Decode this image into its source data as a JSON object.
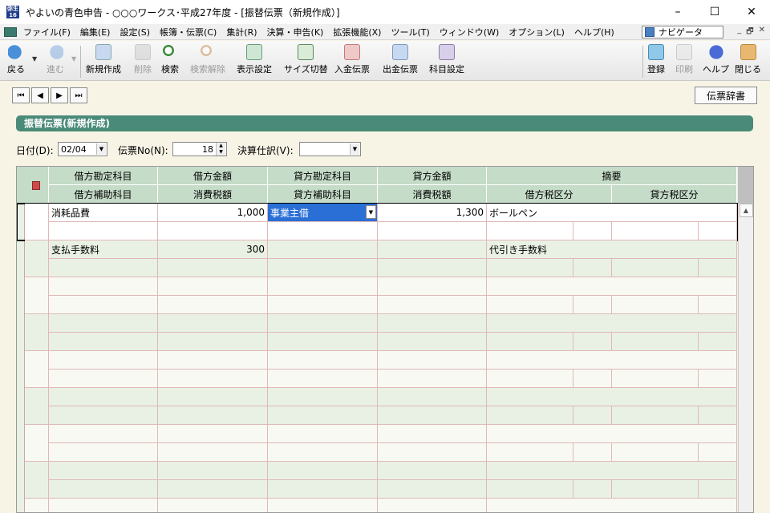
{
  "window": {
    "title": "やよいの青色申告 - ○○○ワークス･平成27年度 - [振替伝票（新規作成）]",
    "icon_text": "弥生16",
    "minimize": "–",
    "maximize": "☐",
    "close": "✕"
  },
  "menu": {
    "items": [
      "ファイル(F)",
      "編集(E)",
      "設定(S)",
      "帳簿・伝票(C)",
      "集計(R)",
      "決算・申告(K)",
      "拡張機能(X)",
      "ツール(T)",
      "ウィンドウ(W)",
      "オプション(L)",
      "ヘルプ(H)"
    ],
    "navigator": "ナビゲータ",
    "mdi": [
      "_",
      "🗗",
      "✕"
    ]
  },
  "toolbar": {
    "back": "戻る",
    "forward": "進む",
    "new": "新規作成",
    "delete": "削除",
    "search": "検索",
    "clear_search": "検索解除",
    "display_settings": "表示設定",
    "size_toggle": "サイズ切替",
    "deposit_slip": "入金伝票",
    "payment_slip": "出金伝票",
    "account_settings": "科目設定",
    "register": "登録",
    "print": "印刷",
    "help": "ヘルプ",
    "close": "閉じる"
  },
  "record_nav": {
    "first": "⏮",
    "prev": "◀",
    "next": "▶",
    "last": "⏭"
  },
  "slip_dictionary": "伝票辞書",
  "section_title": "振替伝票(新規作成)",
  "fields": {
    "date_label": "日付(D):",
    "date_value": "02/04",
    "slip_no_label": "伝票No(N):",
    "slip_no_value": "18",
    "closing_label": "決算仕訳(V):",
    "closing_value": ""
  },
  "grid": {
    "headers_top": [
      "借方勘定科目",
      "借方金額",
      "貸方勘定科目",
      "貸方金額",
      "摘要"
    ],
    "headers_bottom": [
      "借方補助科目",
      "消費税額",
      "貸方補助科目",
      "消費税額",
      "借方税区分",
      "貸方税区分"
    ],
    "rows": [
      {
        "debit_account": "消耗品費",
        "debit_amount": "1,000",
        "credit_account": "事業主借",
        "credit_amount": "1,300",
        "memo": "ボールペン"
      },
      {
        "debit_account": "支払手数料",
        "debit_amount": "300",
        "credit_account": "",
        "credit_amount": "",
        "memo": "代引き手数料"
      }
    ]
  }
}
